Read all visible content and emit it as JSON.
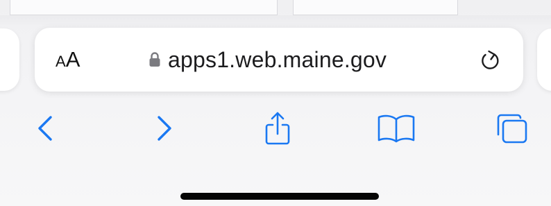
{
  "address_bar": {
    "text_size_small": "A",
    "text_size_large": "A",
    "url": "apps1.web.maine.gov",
    "secure": true
  },
  "toolbar": {
    "buttons": [
      {
        "icon": "chevron-left-icon",
        "name": "back"
      },
      {
        "icon": "chevron-right-icon",
        "name": "forward"
      },
      {
        "icon": "share-icon",
        "name": "share"
      },
      {
        "icon": "book-icon",
        "name": "bookmarks"
      },
      {
        "icon": "tabs-icon",
        "name": "tabs"
      }
    ]
  },
  "colors": {
    "accent": "#1a78f2",
    "text": "#1c1c1e",
    "lock": "#7b7b80",
    "bar_background": "#ffffff",
    "home_indicator": "#050505"
  }
}
